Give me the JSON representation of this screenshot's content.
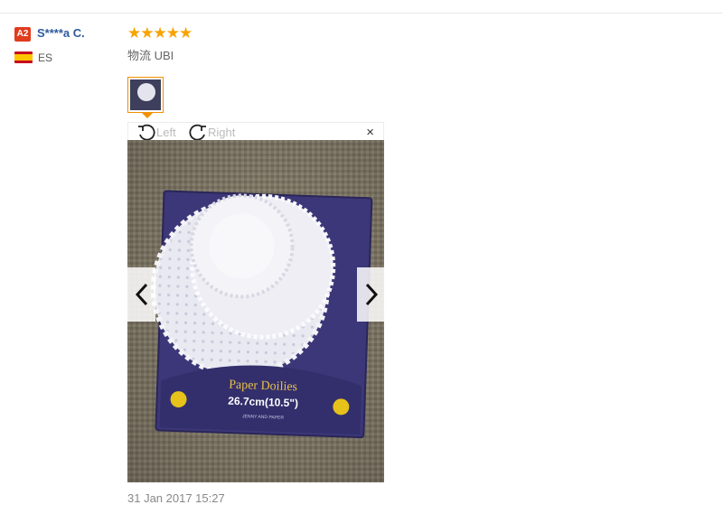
{
  "review": {
    "user": {
      "level_badge": "A2",
      "name": "S****a C.",
      "country_code": "ES"
    },
    "rating": 5,
    "stars_text": "★★★★★",
    "logistics": "物流 UBI",
    "viewer": {
      "rotate_left": "Left",
      "rotate_right": "Right",
      "close": "×"
    },
    "photo_text": {
      "brand": "Paper Doilies",
      "size": "26.7cm(10.5\")",
      "fine_print": "JENNY AND PAPER"
    },
    "date": "31 Jan 2017 15:27"
  },
  "colors": {
    "accent": "#f29100",
    "star": "#f7a300",
    "username": "#2f5a9e",
    "badge": "#e03c1e"
  }
}
